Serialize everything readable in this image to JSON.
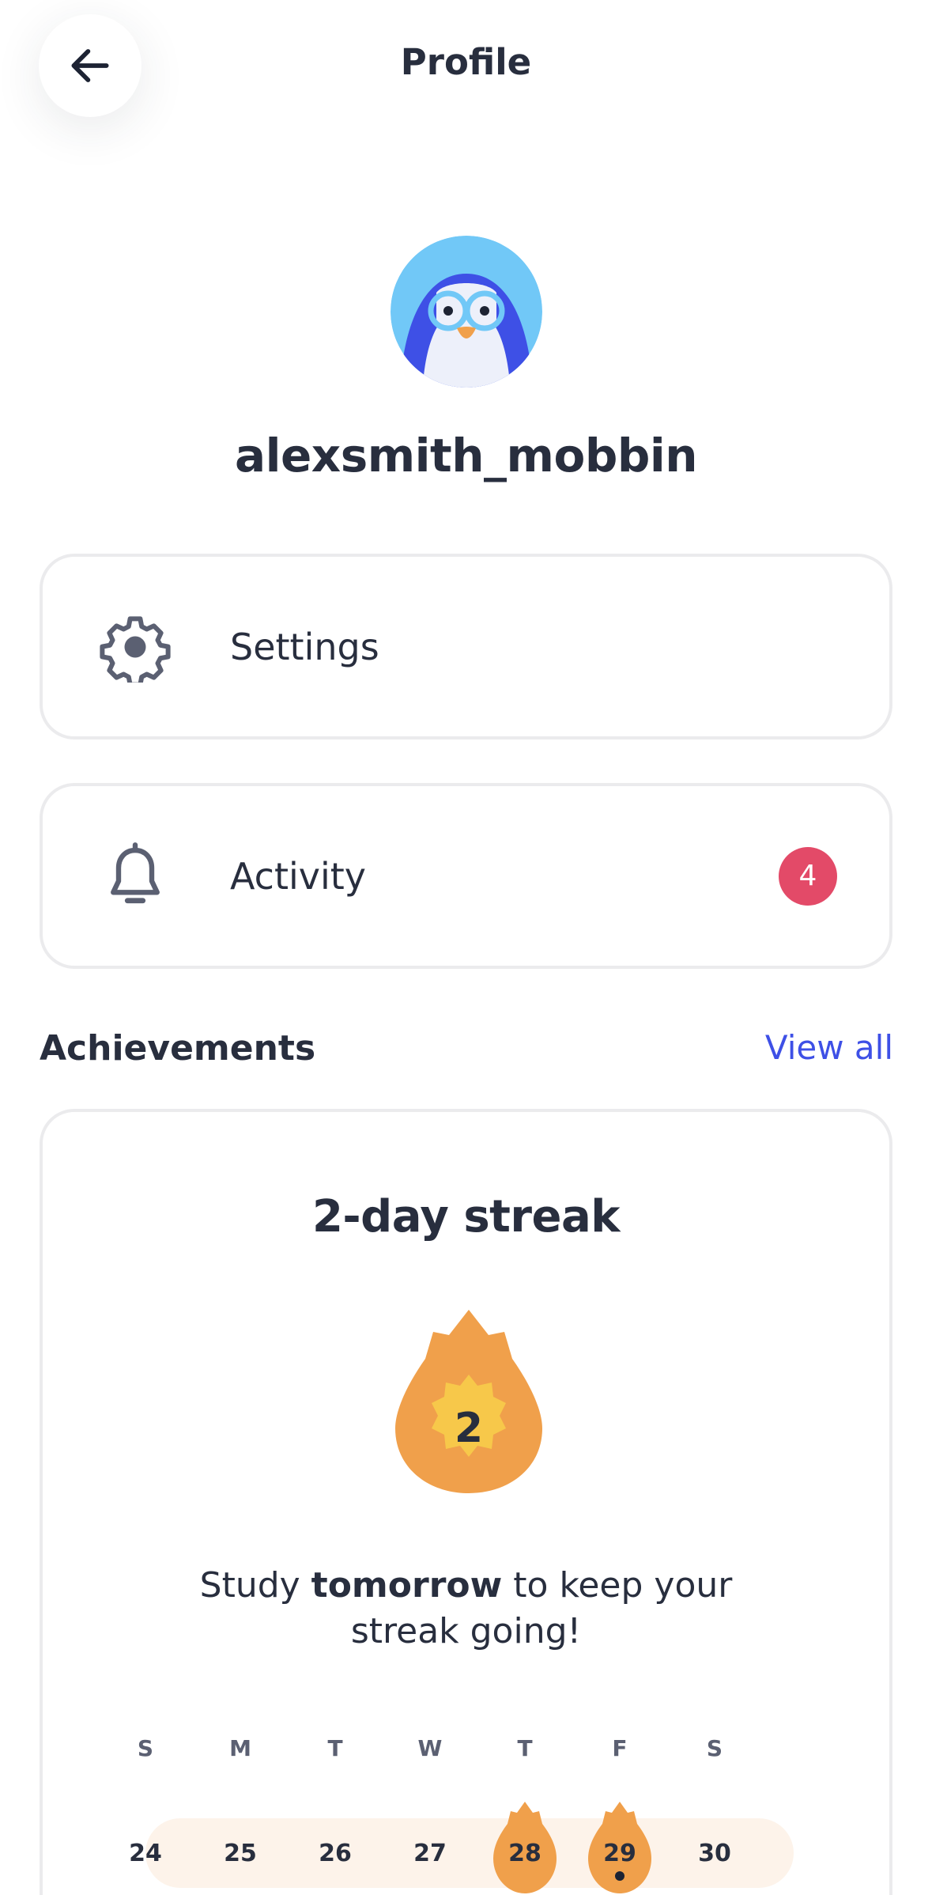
{
  "header": {
    "title": "Profile",
    "back_icon": "arrow-left-icon"
  },
  "profile": {
    "avatar_icon": "penguin-avatar",
    "username": "alexsmith_mobbin"
  },
  "menu": {
    "settings": {
      "label": "Settings",
      "icon": "gear-icon"
    },
    "activity": {
      "label": "Activity",
      "icon": "bell-icon",
      "badge": "4"
    }
  },
  "achievements": {
    "title": "Achievements",
    "view_all": "View all"
  },
  "streak": {
    "title": "2-day streak",
    "count": "2",
    "message_pre": "Study ",
    "message_bold": "tomorrow",
    "message_post": " to keep your streak going!",
    "weekdays": [
      "S",
      "M",
      "T",
      "W",
      "T",
      "F",
      "S"
    ],
    "dates": [
      "24",
      "25",
      "26",
      "27",
      "28",
      "29",
      "30"
    ],
    "streak_days": [
      "28",
      "29"
    ],
    "today": "29"
  },
  "colors": {
    "accent": "#3e50e6",
    "badge": "#e34a68",
    "flame": "#f0a04b",
    "flame_center": "#f7c84a",
    "strip": "#fdf3ea",
    "text": "#282e3e"
  }
}
